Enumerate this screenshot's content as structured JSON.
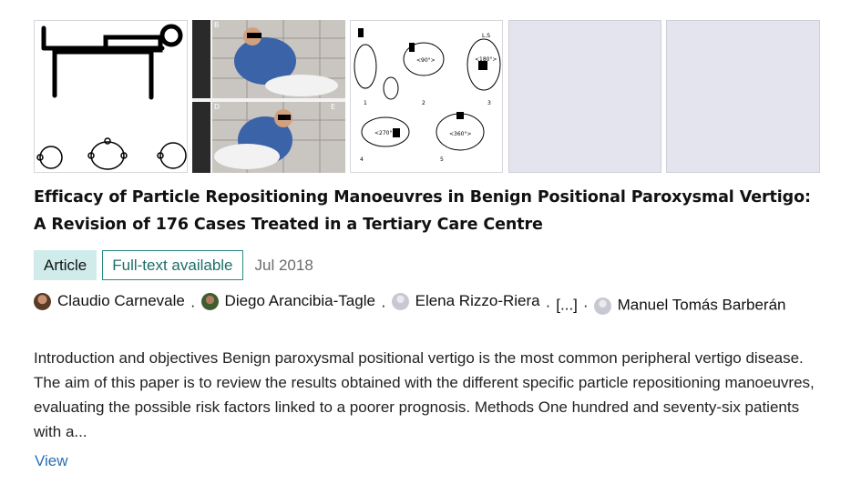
{
  "thumbnails": [
    {
      "label": "",
      "kind": "drawing"
    },
    {
      "label": "",
      "kind": "photo-grid",
      "panel_letters": [
        "B",
        "D",
        "E"
      ]
    },
    {
      "label": "",
      "kind": "diagram",
      "texts": [
        "L.S",
        "<90°>",
        "<180°>",
        "<270°>",
        "<360°>",
        "1",
        "2",
        "3",
        "4",
        "5"
      ]
    },
    {
      "label": "",
      "kind": "placeholder"
    },
    {
      "label": "",
      "kind": "placeholder"
    }
  ],
  "title": "Efficacy of Particle Repositioning Manoeuvres in Benign Positional Paroxysmal Vertigo: A Revision of 176 Cases Treated in a Tertiary Care Centre",
  "badges": {
    "type": "Article",
    "availability": "Full-text available",
    "date": "Jul 2018"
  },
  "authors": {
    "a1": "Claudio Carnevale",
    "a2": "Diego Arancibia-Tagle",
    "a3": "Elena Rizzo-Riera",
    "more": "[...]",
    "a4": "Manuel Tomás Barberán",
    "separator": "·"
  },
  "abstract": "Introduction and objectives Benign paroxysmal positional vertigo is the most common peripheral vertigo disease. The aim of this paper is to review the results obtained with the different specific particle repositioning manoeuvres, evaluating the possible risk factors linked to a poorer prognosis. Methods One hundred and seventy-six patients with a...",
  "actions": {
    "view": "View"
  },
  "colors": {
    "article_badge_bg": "#cfecea",
    "fulltext_border": "#2b8a84",
    "link": "#2b6fb0",
    "placeholder_bg": "#e4e4ee"
  }
}
